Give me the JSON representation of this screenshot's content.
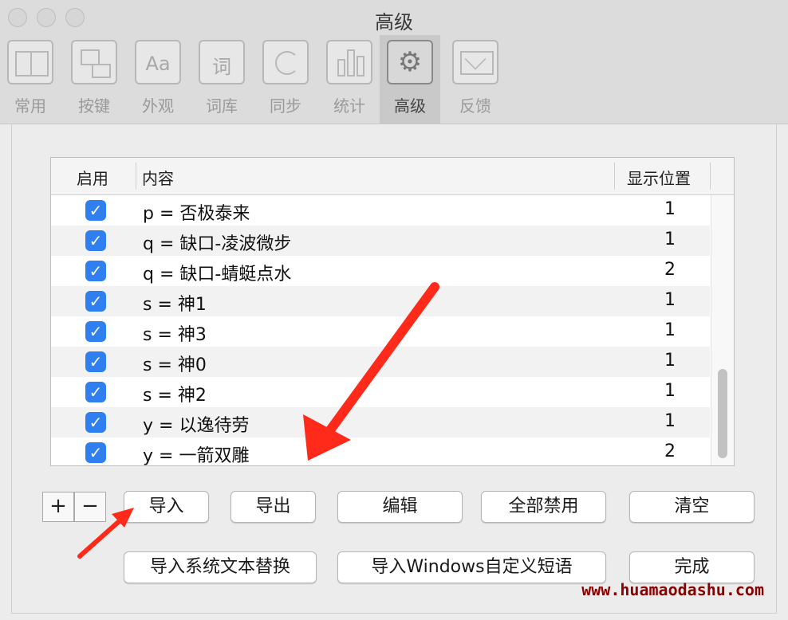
{
  "window": {
    "title": "高级"
  },
  "toolbar": {
    "items": [
      {
        "label": "常用",
        "icon": "layout-icon"
      },
      {
        "label": "按键",
        "icon": "keys-icon"
      },
      {
        "label": "外观",
        "icon": "font-icon",
        "glyph": "Aa"
      },
      {
        "label": "词库",
        "icon": "dictionary-icon",
        "glyph": "词"
      },
      {
        "label": "同步",
        "icon": "sync-icon"
      },
      {
        "label": "统计",
        "icon": "chart-icon"
      },
      {
        "label": "高级",
        "icon": "gear-icon",
        "active": true
      },
      {
        "label": "反馈",
        "icon": "mail-icon"
      }
    ]
  },
  "table": {
    "headers": {
      "enabled": "启用",
      "content": "内容",
      "position": "显示位置"
    },
    "rows": [
      {
        "content": "p = 否极泰来",
        "position": "1"
      },
      {
        "content": "q = 缺口-凌波微步",
        "position": "1"
      },
      {
        "content": "q = 缺口-蜻蜓点水",
        "position": "2"
      },
      {
        "content": "s = 神1",
        "position": "1"
      },
      {
        "content": "s = 神3",
        "position": "1"
      },
      {
        "content": "s = 神0",
        "position": "1"
      },
      {
        "content": "s = 神2",
        "position": "1"
      },
      {
        "content": "y = 以逸待劳",
        "position": "1"
      },
      {
        "content": "y = 一箭双雕",
        "position": "2"
      }
    ]
  },
  "controls": {
    "plus": "+",
    "minus": "−",
    "import": "导入",
    "export": "导出",
    "edit": "编辑",
    "disable_all": "全部禁用",
    "clear": "清空",
    "import_system": "导入系统文本替换",
    "import_windows": "导入Windows自定义短语",
    "done": "完成"
  },
  "watermark": "www.huamaodashu.com",
  "colors": {
    "accent": "#2f7ff0",
    "arrow": "#ff2a1a",
    "watermark": "#8b0000"
  }
}
